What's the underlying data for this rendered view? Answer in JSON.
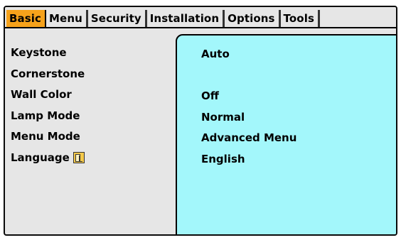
{
  "tabs": [
    "Basic",
    "Menu",
    "Security",
    "Installation",
    "Options",
    "Tools"
  ],
  "rows": [
    {
      "label": "Keystone",
      "value": "Auto"
    },
    {
      "label": "Cornerstone",
      "value": ""
    },
    {
      "label": "Wall Color",
      "value": "Off"
    },
    {
      "label": "Lamp Mode",
      "value": "Normal"
    },
    {
      "label": "Menu Mode",
      "value": "Advanced Menu"
    },
    {
      "label": "Language",
      "value": "English",
      "icon": "language-icon"
    }
  ],
  "colors": {
    "active_tab": "#f6a21b",
    "value_panel": "#a3f7fb",
    "background": "#e6e6e6"
  }
}
